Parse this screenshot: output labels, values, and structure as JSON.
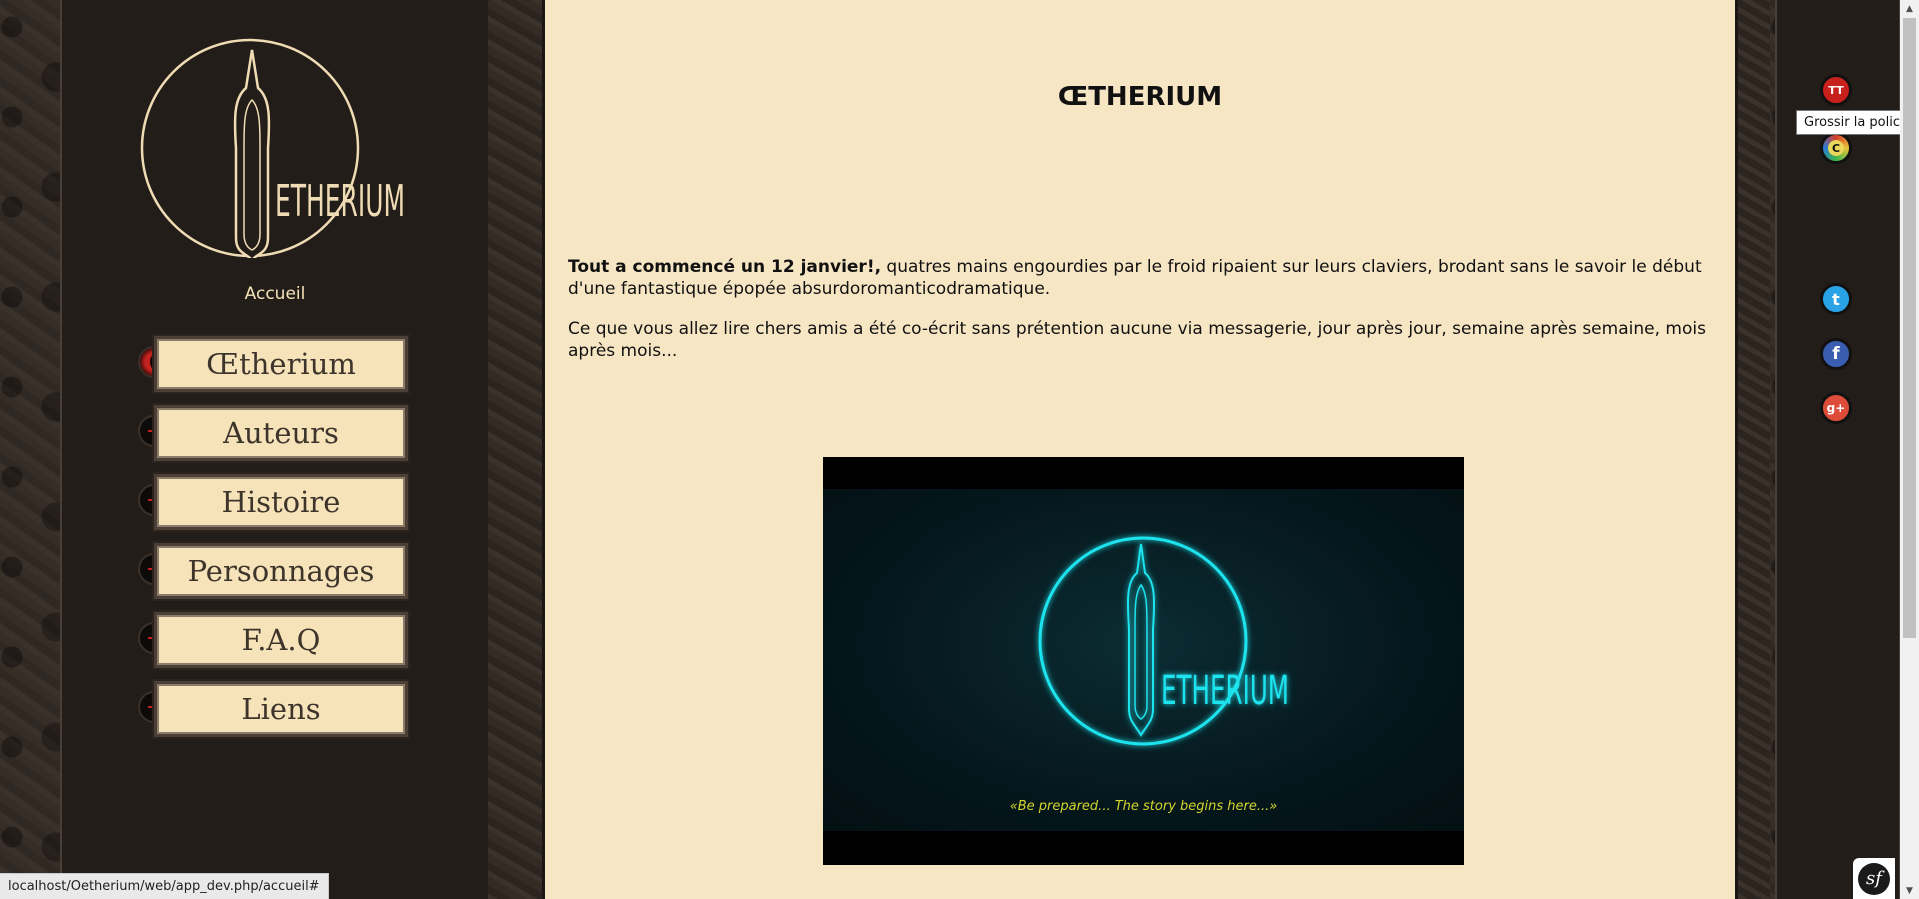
{
  "site": {
    "logo_text": "ŒTHERIUM",
    "home_link": "Accueil"
  },
  "nav": {
    "items": [
      {
        "label": "Œtherium",
        "active": true
      },
      {
        "label": "Auteurs",
        "active": false
      },
      {
        "label": "Histoire",
        "active": false
      },
      {
        "label": "Personnages",
        "active": false
      },
      {
        "label": "F.A.Q",
        "active": false
      },
      {
        "label": "Liens",
        "active": false
      }
    ],
    "bullet_dash": "--"
  },
  "main": {
    "title": "ŒTHERIUM",
    "para1_bold": "Tout a commencé un 12 janvier!,",
    "para1_rest": " quatres mains engourdies par le froid ripaient sur leurs claviers, brodant sans le savoir le début d'une fantastique épopée absurdoromanticodramatique.",
    "para2": "Ce que vous allez lire chers amis a été co-écrit sans prétention aucune via messagerie, jour après jour, semaine après semaine, mois après mois...",
    "video": {
      "logo_text": "ŒTHERIUM",
      "tagline": "«Be prepared... The story begins here...»"
    }
  },
  "tools": {
    "font_icon_label": "TT",
    "contrast_icon_label": "C",
    "tooltip": "Grossir la police",
    "twitter_label": "t",
    "facebook_label": "f",
    "gplus_label": "g+"
  },
  "statusbar": {
    "url": "localhost/Oetherium/web/app_dev.php/accueil#"
  },
  "colors": {
    "parchment": "#f7e6c4",
    "panel": "#231d19",
    "accent_red": "#c21c1c",
    "neon": "#1ee3ee",
    "tagline": "#d4d52e"
  }
}
